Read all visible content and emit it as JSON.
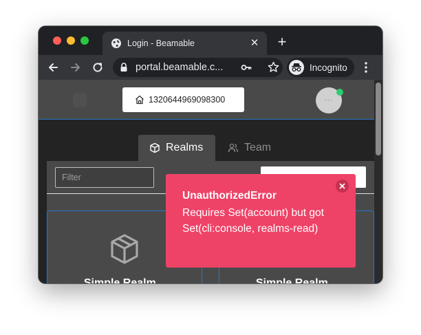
{
  "browser": {
    "tab_title": "Login - Beamable",
    "url": "portal.beamable.c...",
    "profile_label": "Incognito"
  },
  "app": {
    "customer_id": "1320644969098300",
    "tabs": [
      {
        "label": "Realms",
        "active": true
      },
      {
        "label": "Team",
        "active": false
      }
    ],
    "filter_placeholder": "Filter",
    "cards": [
      {
        "title": "Simple Realm..."
      },
      {
        "title": "Simple Realm..."
      }
    ]
  },
  "toast": {
    "title": "UnauthorizedError",
    "message": "Requires Set(account) but got Set(cli:console, realms-read)"
  },
  "colors": {
    "toast_bg": "#ef4267",
    "accent_border": "#2a73c8",
    "online_status": "#2ecc71"
  }
}
